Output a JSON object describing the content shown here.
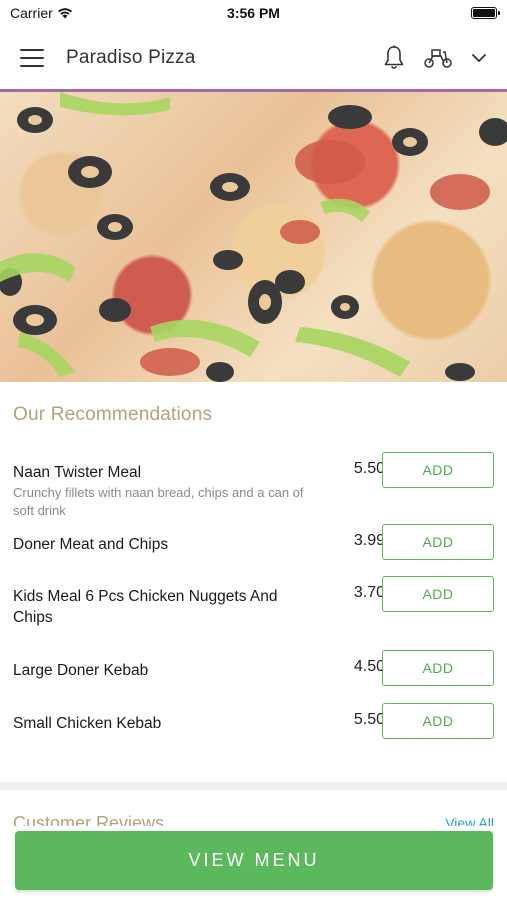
{
  "status_bar": {
    "carrier": "Carrier",
    "time": "3:56 PM"
  },
  "header": {
    "title": "Paradiso Pizza",
    "icons": [
      "menu-icon",
      "bell-icon",
      "scooter-icon",
      "chevron-down-icon"
    ],
    "accent_color": "#a46aa8"
  },
  "recommendations": {
    "title": "Our Recommendations",
    "add_label": "ADD",
    "items": [
      {
        "name": "Naan Twister Meal",
        "description": "Crunchy fillets with naan bread, chips and a can of soft drink",
        "price": "5.50"
      },
      {
        "name": "Doner Meat and Chips",
        "description": "",
        "price": "3.99"
      },
      {
        "name": "Kids Meal 6 Pcs Chicken Nuggets And Chips",
        "description": "",
        "price": "3.70"
      },
      {
        "name": "Large Doner Kebab",
        "description": "",
        "price": "4.50"
      },
      {
        "name": "Small Chicken Kebab",
        "description": "",
        "price": "5.50"
      }
    ]
  },
  "reviews": {
    "title": "Customer Reviews",
    "view_all": "View All"
  },
  "view_menu_button": {
    "label": "VIEW MENU",
    "color": "#5cb85c"
  }
}
